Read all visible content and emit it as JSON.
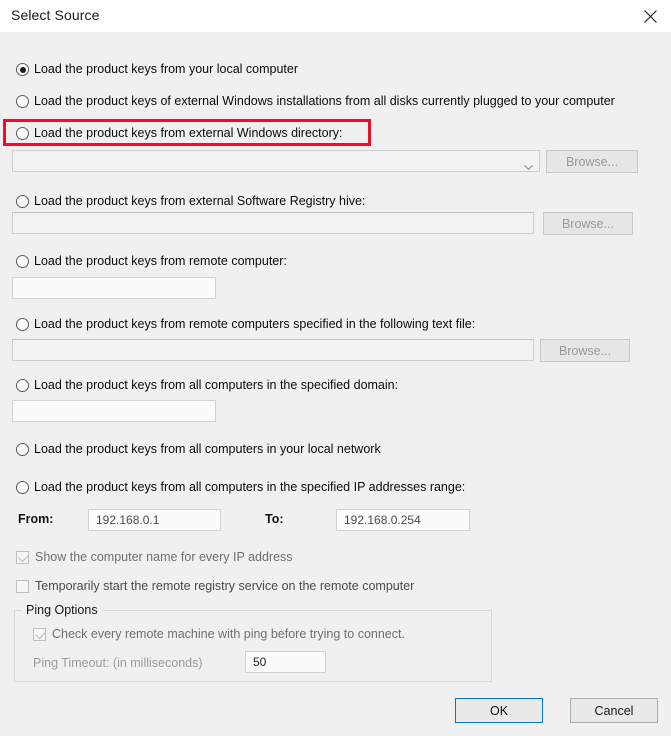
{
  "window": {
    "title": "Select Source",
    "close_icon": "close-icon"
  },
  "options": [
    {
      "id": "local-computer",
      "label": "Load the product keys from your local computer",
      "selected": true
    },
    {
      "id": "external-windows-disks",
      "label": "Load the product keys of external Windows installations from all disks currently plugged to your computer",
      "selected": false
    },
    {
      "id": "external-windows-directory",
      "label": "Load the product keys from external Windows directory:",
      "selected": false
    },
    {
      "id": "external-registry-hive",
      "label": "Load the product keys from external Software Registry hive:",
      "selected": false
    },
    {
      "id": "remote-computer",
      "label": "Load the product keys from remote computer:",
      "selected": false
    },
    {
      "id": "remote-computers-text-file",
      "label": "Load the product keys from remote computers specified in the following text file:",
      "selected": false
    },
    {
      "id": "specified-domain",
      "label": "Load the product keys from all computers in the specified domain:",
      "selected": false
    },
    {
      "id": "local-network",
      "label": "Load the product keys from all computers in your local network",
      "selected": false
    },
    {
      "id": "ip-range",
      "label": "Load the product keys from all computers in the specified IP addresses range:",
      "selected": false
    }
  ],
  "fields": {
    "windows_directory": {
      "value": "",
      "placeholder": ""
    },
    "registry_hive": {
      "value": "",
      "placeholder": ""
    },
    "remote_computer": {
      "value": "",
      "placeholder": ""
    },
    "text_file": {
      "value": "",
      "placeholder": ""
    },
    "domain": {
      "value": "",
      "placeholder": ""
    },
    "ip_from": {
      "label": "From:",
      "value": "192.168.0.1"
    },
    "ip_to": {
      "label": "To:",
      "value": "192.168.0.254"
    },
    "ping_timeout": {
      "label": "Ping Timeout: (in milliseconds)",
      "value": "50"
    }
  },
  "buttons": {
    "browse_directory": "Browse...",
    "browse_hive": "Browse...",
    "browse_textfile": "Browse...",
    "ok": "OK",
    "cancel": "Cancel"
  },
  "checkboxes": [
    {
      "id": "show-computer-name",
      "label": "Show the computer name for every IP address",
      "checked": true,
      "enabled": false
    },
    {
      "id": "start-remote-registry",
      "label": "Temporarily start the remote registry service on the remote computer",
      "checked": false,
      "enabled": true
    },
    {
      "id": "ping-check",
      "label": "Check every remote machine with ping before trying to connect.",
      "checked": true,
      "enabled": false
    }
  ],
  "ping_options": {
    "legend": "Ping Options"
  },
  "icons": {
    "chevron_down": "chevron-down-icon"
  },
  "annotation": {
    "highlight_color": "#e8112d",
    "target_option_id": "external-windows-directory"
  }
}
